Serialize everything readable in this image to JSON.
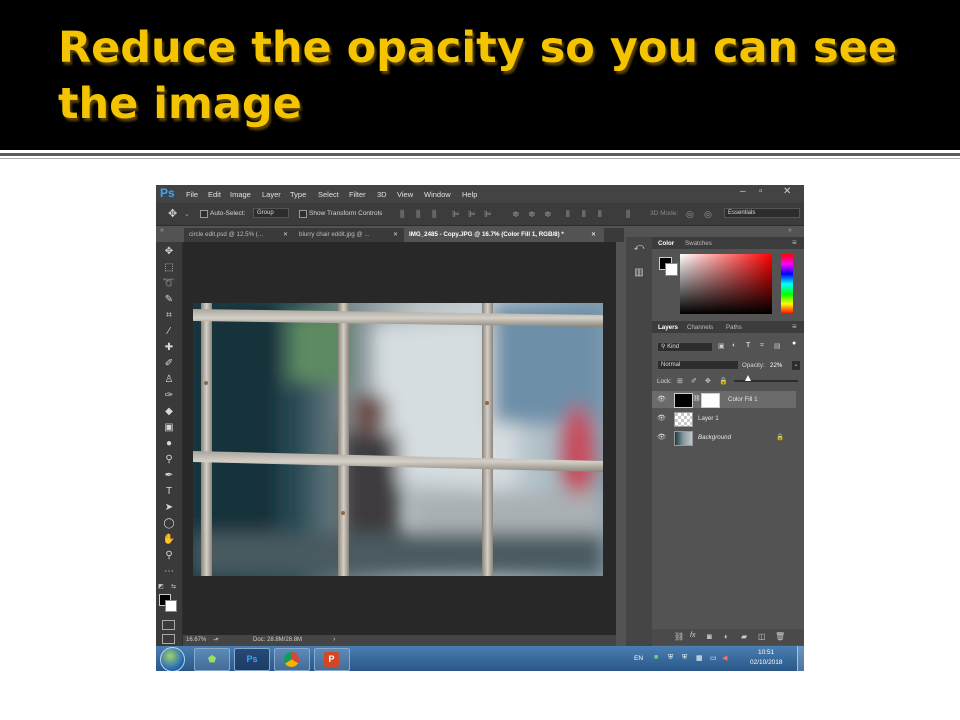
{
  "slide": {
    "title": "Reduce the opacity so you can see the image"
  },
  "app": {
    "logo": "Ps",
    "menu": [
      "File",
      "Edit",
      "Image",
      "Layer",
      "Type",
      "Select",
      "Filter",
      "3D",
      "View",
      "Window",
      "Help"
    ],
    "window_controls": [
      "–",
      "▫",
      "✕"
    ]
  },
  "options_bar": {
    "auto_select_label": "Auto-Select:",
    "auto_select_value": "Group",
    "show_transform_label": "Show Transform Controls",
    "mode_3d_label": "3D Mode:",
    "workspace": "Essentials"
  },
  "tabs": [
    {
      "label": "circle edit.psd @ 12.5% (...",
      "close": "✕"
    },
    {
      "label": "blurry chair eddit.jpg @ ...",
      "close": "✕"
    },
    {
      "label": "IMG_2485 - Copy.JPG @ 16.7% (Color Fill 1, RGB/8) *",
      "close": "✕"
    }
  ],
  "status": {
    "zoom": "16.67%",
    "doc": "Doc: 28.8M/28.8M",
    "arrow": "›"
  },
  "color_panel": {
    "tabs": [
      "Color",
      "Swatches"
    ]
  },
  "layers_panel": {
    "tabs": [
      "Layers",
      "Channels",
      "Paths"
    ],
    "filter_label": "Kind",
    "blend_mode": "Normal",
    "opacity_label": "Opacity:",
    "opacity_value": "22%",
    "opacity_fraction": 0.22,
    "lock_label": "Lock:",
    "layers": [
      {
        "name": "Color Fill 1",
        "selected": true
      },
      {
        "name": "Layer 1",
        "selected": false
      },
      {
        "name": "Background",
        "selected": false
      }
    ],
    "bottom_icons": [
      "link-icon",
      "fx-icon",
      "mask-icon",
      "adjustment-icon",
      "group-icon",
      "new-layer-icon",
      "trash-icon"
    ]
  },
  "taskbar": {
    "language": "EN",
    "time": "10:51",
    "date": "02/10/2018",
    "apps": [
      "start-orb",
      "winrar",
      "photoshop",
      "chrome",
      "powerpoint"
    ]
  },
  "colors": {
    "title_yellow": "#f5c400",
    "ps_panel": "#535353",
    "ps_dark": "#282828",
    "ps_blue": "#31a8ff"
  }
}
